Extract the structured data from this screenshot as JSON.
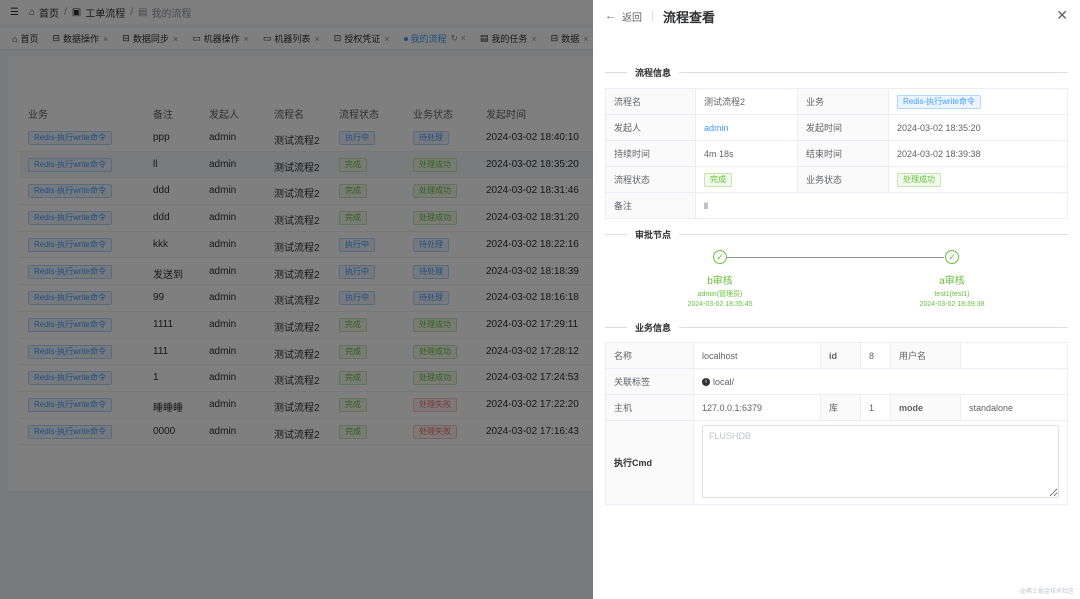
{
  "breadcrumb": {
    "home": "首页",
    "workflow": "工单流程",
    "current": "我的流程"
  },
  "tabs": [
    {
      "label": "首页",
      "icon": "home-icon"
    },
    {
      "label": "数据操作",
      "icon": "database-icon"
    },
    {
      "label": "数据同步",
      "icon": "database-icon"
    },
    {
      "label": "机器操作",
      "icon": "monitor-icon"
    },
    {
      "label": "机器列表",
      "icon": "monitor-icon"
    },
    {
      "label": "授权凭证",
      "icon": "lock-icon"
    },
    {
      "label": "我的流程",
      "icon": "dot-icon",
      "active": true
    },
    {
      "label": "我的任务",
      "icon": "task-icon"
    },
    {
      "label": "数据",
      "icon": "database-icon"
    }
  ],
  "table": {
    "headers": [
      "业务",
      "备注",
      "发起人",
      "流程名",
      "流程状态",
      "业务状态",
      "发起时间"
    ],
    "rows": [
      {
        "biz": "Redis-执行write命令",
        "remark": "ppp",
        "creator": "admin",
        "name": "测试流程2",
        "status": "执行中",
        "bizStatus": "待处理",
        "time": "2024-03-02 18:40:10"
      },
      {
        "biz": "Redis-执行write命令",
        "remark": "ll",
        "creator": "admin",
        "name": "测试流程2",
        "status": "完成",
        "bizStatus": "处理成功",
        "time": "2024-03-02 18:35:20"
      },
      {
        "biz": "Redis-执行write命令",
        "remark": "ddd",
        "creator": "admin",
        "name": "测试流程2",
        "status": "完成",
        "bizStatus": "处理成功",
        "time": "2024-03-02 18:31:46"
      },
      {
        "biz": "Redis-执行write命令",
        "remark": "ddd",
        "creator": "admin",
        "name": "测试流程2",
        "status": "完成",
        "bizStatus": "处理成功",
        "time": "2024-03-02 18:31:20"
      },
      {
        "biz": "Redis-执行write命令",
        "remark": "kkk",
        "creator": "admin",
        "name": "测试流程2",
        "status": "执行中",
        "bizStatus": "待处理",
        "time": "2024-03-02 18:22:16"
      },
      {
        "biz": "Redis-执行write命令",
        "remark": "发送到",
        "creator": "admin",
        "name": "测试流程2",
        "status": "执行中",
        "bizStatus": "待处理",
        "time": "2024-03-02 18:18:39"
      },
      {
        "biz": "Redis-执行write命令",
        "remark": "99",
        "creator": "admin",
        "name": "测试流程2",
        "status": "执行中",
        "bizStatus": "待处理",
        "time": "2024-03-02 18:16:18"
      },
      {
        "biz": "Redis-执行write命令",
        "remark": "1111",
        "creator": "admin",
        "name": "测试流程2",
        "status": "完成",
        "bizStatus": "处理成功",
        "time": "2024-03-02 17:29:11"
      },
      {
        "biz": "Redis-执行write命令",
        "remark": "111",
        "creator": "admin",
        "name": "测试流程2",
        "status": "完成",
        "bizStatus": "处理成功",
        "time": "2024-03-02 17:28:12"
      },
      {
        "biz": "Redis-执行write命令",
        "remark": "1",
        "creator": "admin",
        "name": "测试流程2",
        "status": "完成",
        "bizStatus": "处理成功",
        "time": "2024-03-02 17:24:53"
      },
      {
        "biz": "Redis-执行write命令",
        "remark": "睡睡睡",
        "creator": "admin",
        "name": "测试流程2",
        "status": "完成",
        "bizStatus": "处理失败",
        "time": "2024-03-02 17:22:20"
      },
      {
        "biz": "Redis-执行write命令",
        "remark": "0000",
        "creator": "admin",
        "name": "测试流程2",
        "status": "完成",
        "bizStatus": "处理失败",
        "time": "2024-03-02 17:16:43"
      }
    ]
  },
  "drawer": {
    "back": "返回",
    "title": "流程查看",
    "section_flow": "流程信息",
    "section_approve": "审批节点",
    "section_biz": "业务信息",
    "flow": {
      "name_label": "流程名",
      "name": "测试流程2",
      "biz_label": "业务",
      "biz": "Redis-执行write命令",
      "creator_label": "发起人",
      "creator": "admin",
      "time_label": "发起时间",
      "time": "2024-03-02 18:35:20",
      "duration_label": "持续时间",
      "duration": "4m 18s",
      "end_label": "结束时间",
      "end": "2024-03-02 18:39:38",
      "status_label": "流程状态",
      "status": "完成",
      "biz_status_label": "业务状态",
      "biz_status": "处理成功",
      "remark_label": "备注",
      "remark": "ll"
    },
    "steps": [
      {
        "title": "b审核",
        "user": "admin(管理员)",
        "time": "2024-03-02 18:35:45"
      },
      {
        "title": "a审核",
        "user": "test1(test1)",
        "time": "2024-03-02 18:39:38"
      }
    ],
    "biz": {
      "name_label": "名称",
      "name": "localhost",
      "id_label": "id",
      "id": "8",
      "user_label": "用户名",
      "user": "",
      "tag_label": "关联标签",
      "tag": "local/",
      "host_label": "主机",
      "host": "127.0.0.1:6379",
      "db_label": "库",
      "db": "1",
      "mode_label": "mode",
      "mode": "standalone",
      "cmd_label": "执行Cmd",
      "cmd_placeholder": "FLUSHDB"
    }
  },
  "watermark": "@稀土掘金技术社区"
}
